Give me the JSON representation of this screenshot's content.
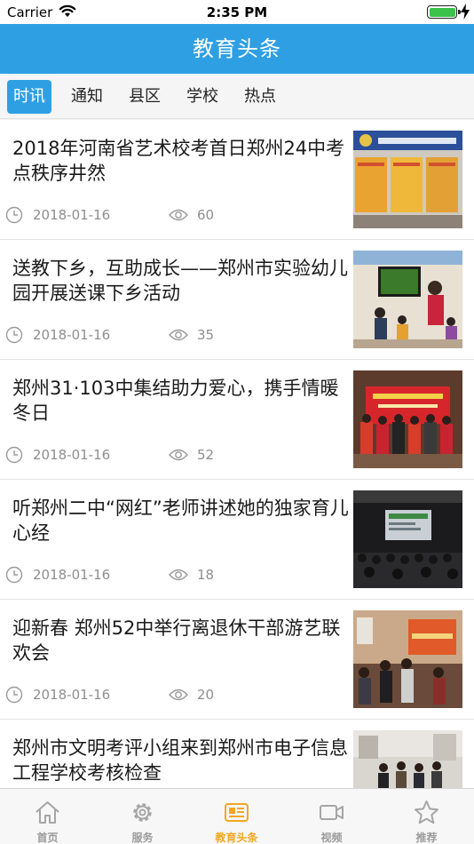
{
  "status_bar": {
    "carrier": "Carrier",
    "time": "2:35 PM"
  },
  "nav": {
    "title": "教育头条"
  },
  "tabs": [
    {
      "label": "时讯",
      "active": true
    },
    {
      "label": "通知",
      "active": false
    },
    {
      "label": "县区",
      "active": false
    },
    {
      "label": "学校",
      "active": false
    },
    {
      "label": "热点",
      "active": false
    }
  ],
  "news": [
    {
      "title": "2018年河南省艺术校考首日郑州24中考点秩序井然",
      "date": "2018-01-16",
      "views": "60"
    },
    {
      "title": "送教下乡，互助成长——郑州市实验幼儿园开展送课下乡活动",
      "date": "2018-01-16",
      "views": "35"
    },
    {
      "title": "郑州31·103中集结助力爱心，携手情暖冬日",
      "date": "2018-01-16",
      "views": "52"
    },
    {
      "title": "听郑州二中“网红”老师讲述她的独家育儿心经",
      "date": "2018-01-16",
      "views": "18"
    },
    {
      "title": "迎新春 郑州52中举行离退休干部游艺联欢会",
      "date": "2018-01-16",
      "views": "20"
    },
    {
      "title": "郑州市文明考评小组来到郑州市电子信息工程学校考核检查",
      "date": "",
      "views": ""
    }
  ],
  "tab_bar": [
    {
      "label": "首页",
      "icon": "home-icon",
      "active": false
    },
    {
      "label": "服务",
      "icon": "gear-icon",
      "active": false
    },
    {
      "label": "教育头条",
      "icon": "newspaper-icon",
      "active": true
    },
    {
      "label": "视频",
      "icon": "video-icon",
      "active": false
    },
    {
      "label": "推荐",
      "icon": "star-icon",
      "active": false
    }
  ],
  "colors": {
    "accent": "#2f9fe4",
    "active_tab": "#f5a623",
    "inactive_tab": "#9a9a9a",
    "battery": "#3bc24a"
  }
}
